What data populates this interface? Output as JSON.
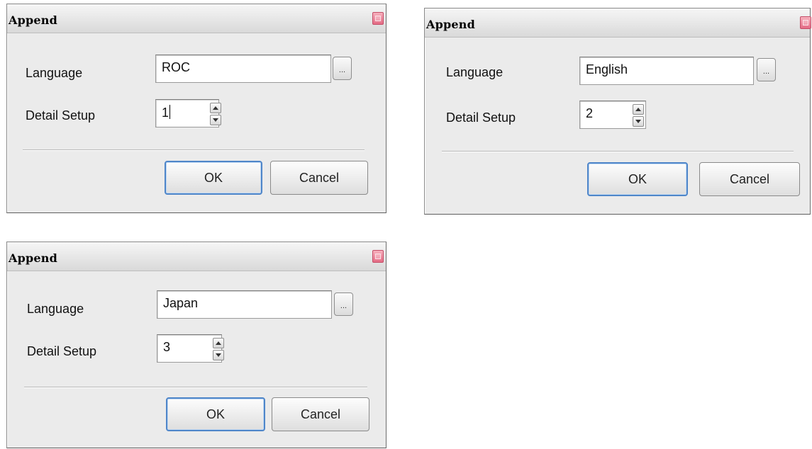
{
  "dialogs": [
    {
      "title": "Append",
      "language_label": "Language",
      "language_value": "ROC",
      "browse_label": "...",
      "detail_label": "Detail Setup",
      "detail_value": "1",
      "ok_label": "OK",
      "cancel_label": "Cancel",
      "has_caret": true
    },
    {
      "title": "Append",
      "language_label": "Language",
      "language_value": "English",
      "browse_label": "...",
      "detail_label": "Detail Setup",
      "detail_value": "2",
      "ok_label": "OK",
      "cancel_label": "Cancel",
      "has_caret": false
    },
    {
      "title": "Append",
      "language_label": "Language",
      "language_value": "Japan",
      "browse_label": "...",
      "detail_label": "Detail Setup",
      "detail_value": "3",
      "ok_label": "OK",
      "cancel_label": "Cancel",
      "has_caret": false
    }
  ],
  "icons": {
    "close": "close-icon",
    "spin_up": "chevron-up-icon",
    "spin_down": "chevron-down-icon"
  }
}
